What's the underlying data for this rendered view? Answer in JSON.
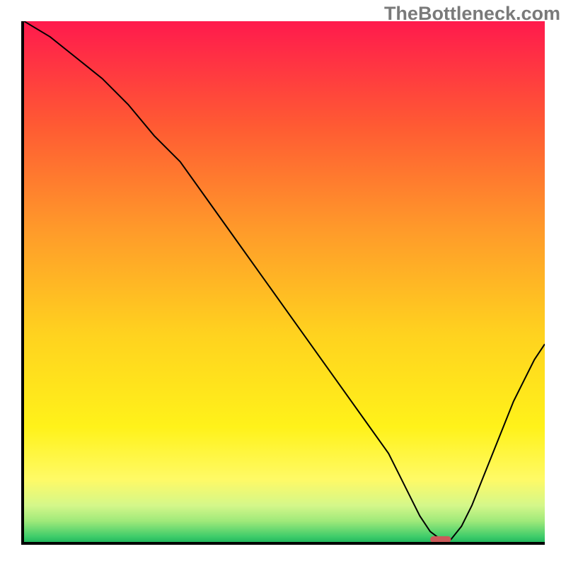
{
  "watermark": "TheBottleneck.com",
  "chart_data": {
    "type": "line",
    "title": "",
    "xlabel": "",
    "ylabel": "",
    "xlim": [
      0,
      100
    ],
    "ylim": [
      0,
      100
    ],
    "x": [
      0,
      5,
      10,
      15,
      20,
      25,
      30,
      35,
      40,
      45,
      50,
      55,
      60,
      65,
      70,
      72,
      74,
      76,
      78,
      80,
      82,
      84,
      86,
      88,
      90,
      92,
      94,
      96,
      98,
      100
    ],
    "y": [
      100,
      97,
      93,
      89,
      84,
      78,
      73,
      66,
      59,
      52,
      45,
      38,
      31,
      24,
      17,
      13,
      9,
      5,
      2,
      0.5,
      0.5,
      3,
      7,
      12,
      17,
      22,
      27,
      31,
      35,
      38
    ],
    "marker": {
      "x": 80,
      "y": 0.5,
      "width": 4,
      "height": 1.2,
      "color": "#cc5a5a"
    },
    "background_gradient": {
      "stops": [
        {
          "offset": 0.0,
          "color": "#ff1a4d"
        },
        {
          "offset": 0.2,
          "color": "#ff5a33"
        },
        {
          "offset": 0.4,
          "color": "#ff9a2a"
        },
        {
          "offset": 0.6,
          "color": "#ffd21f"
        },
        {
          "offset": 0.78,
          "color": "#fff21a"
        },
        {
          "offset": 0.88,
          "color": "#fffa66"
        },
        {
          "offset": 0.93,
          "color": "#d4f78a"
        },
        {
          "offset": 0.96,
          "color": "#9fe97a"
        },
        {
          "offset": 0.99,
          "color": "#3ecc6a"
        },
        {
          "offset": 1.0,
          "color": "#23b85e"
        }
      ]
    }
  }
}
